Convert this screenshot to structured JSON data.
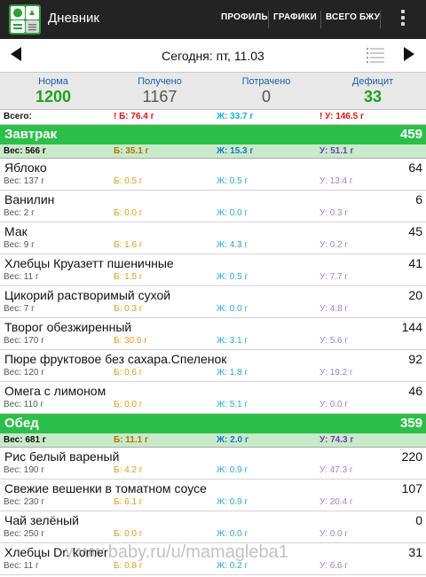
{
  "actionbar": {
    "title": "Дневник",
    "menu": [
      "ПРОФИЛЬ",
      "ГРАФИКИ",
      "ВСЕГО БЖУ"
    ]
  },
  "datebar": {
    "date": "Сегодня: пт, 11.03"
  },
  "summary": [
    {
      "label": "Норма",
      "value": "1200"
    },
    {
      "label": "Получено",
      "value": "1167"
    },
    {
      "label": "Потрачено",
      "value": "0"
    },
    {
      "label": "Дефицит",
      "value": "33"
    }
  ],
  "totals": {
    "label": "Всего:",
    "b": "! Б: 76.4 г",
    "zh": "Ж: 33.7 г",
    "u": "! У: 146.5 г"
  },
  "meals": [
    {
      "name": "Завтрак",
      "kcal": "459",
      "weight": "Вес: 566 г",
      "b": "Б: 35.1 г",
      "zh": "Ж: 15.3 г",
      "u": "У: 51.1 г",
      "items": [
        {
          "name": "Яблоко",
          "kcal": "64",
          "weight": "Вес: 137 г",
          "b": "Б: 0.5 г",
          "zh": "Ж: 0.5 г",
          "u": "У: 13.4 г"
        },
        {
          "name": "Ванилин",
          "kcal": "6",
          "weight": "Вес: 2 г",
          "b": "Б: 0.0 г",
          "zh": "Ж: 0.0 г",
          "u": "У: 0.3 г"
        },
        {
          "name": "Мак",
          "kcal": "45",
          "weight": "Вес: 9 г",
          "b": "Б: 1.6 г",
          "zh": "Ж: 4.3 г",
          "u": "У: 0.2 г"
        },
        {
          "name": "Хлебцы Круазетт пшеничные",
          "kcal": "41",
          "weight": "Вес: 11 г",
          "b": "Б: 1.5 г",
          "zh": "Ж: 0.5 г",
          "u": "У: 7.7 г"
        },
        {
          "name": "Цикорий растворимый сухой",
          "kcal": "20",
          "weight": "Вес: 7 г",
          "b": "Б: 0.3 г",
          "zh": "Ж: 0.0 г",
          "u": "У: 4.8 г"
        },
        {
          "name": "Творог обезжиренный",
          "kcal": "144",
          "weight": "Вес: 170 г",
          "b": "Б: 30.6 г",
          "zh": "Ж: 3.1 г",
          "u": "У: 5.6 г"
        },
        {
          "name": "Пюре фруктовое без сахара.Спеленок",
          "kcal": "92",
          "weight": "Вес: 120 г",
          "b": "Б: 0.6 г",
          "zh": "Ж: 1.8 г",
          "u": "У: 19.2 г"
        },
        {
          "name": "Омега с лимоном",
          "kcal": "46",
          "weight": "Вес: 110 г",
          "b": "Б: 0.0 г",
          "zh": "Ж: 5.1 г",
          "u": "У: 0.0 г"
        }
      ]
    },
    {
      "name": "Обед",
      "kcal": "359",
      "weight": "Вес: 681 г",
      "b": "Б: 11.1 г",
      "zh": "Ж: 2.0 г",
      "u": "У: 74.3 г",
      "items": [
        {
          "name": "Рис белый вареный",
          "kcal": "220",
          "weight": "Вес: 190 г",
          "b": "Б: 4.2 г",
          "zh": "Ж: 0.9 г",
          "u": "У: 47.3 г"
        },
        {
          "name": "Свежие вешенки в томатном соусе",
          "kcal": "107",
          "weight": "Вес: 230 г",
          "b": "Б: 6.1 г",
          "zh": "Ж: 0.9 г",
          "u": "У: 20.4 г"
        },
        {
          "name": "Чай зелёный",
          "kcal": "0",
          "weight": "Вес: 250 г",
          "b": "Б: 0.0 г",
          "zh": "Ж: 0.0 г",
          "u": "У: 0.0 г"
        },
        {
          "name": "Хлебцы Dr. korner",
          "kcal": "31",
          "weight": "Вес: 11 г",
          "b": "Б: 0.8 г",
          "zh": "Ж: 0.2 г",
          "u": "У: 6.6 г"
        }
      ]
    }
  ],
  "watermark": "www.baby.ru/u/mamagleba1"
}
